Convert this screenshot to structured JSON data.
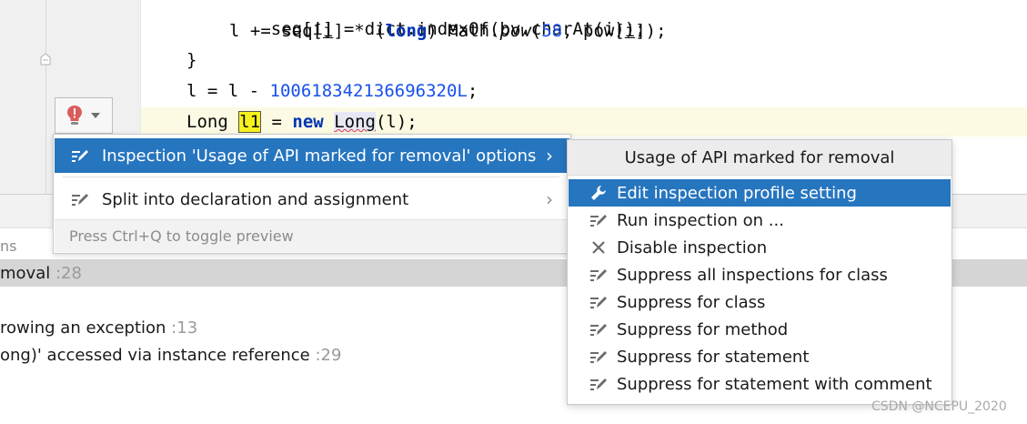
{
  "editor": {
    "code_lines": [
      {
        "a": "seq[i] = dict.indexOf(bv.charAt(i));"
      },
      {
        "a": "l += seq[",
        "b": "i",
        "c": "] * (",
        "kw": "long",
        "d": ") Math.",
        "it": "pow",
        "e": "(",
        "num": "58",
        "f": ", pow[",
        "g": "i",
        "h": "]);"
      },
      {
        "a": "}"
      },
      {
        "a": "l = l - ",
        "num": "100618342136696320L",
        "b": ";"
      },
      {
        "a": "Long ",
        "var": "l1",
        "b": " = ",
        "kw": "new",
        "c": " ",
        "dep": "Long",
        "d": "(l);"
      }
    ]
  },
  "intention_menu": {
    "items": [
      {
        "label": "Inspection 'Usage of API marked for removal' options",
        "icon": "pencil-icon",
        "arrow": "›"
      },
      {
        "label": "Split into declaration and assignment",
        "icon": "pencil-icon",
        "arrow": "›"
      }
    ],
    "footer": "Press Ctrl+Q to toggle preview"
  },
  "submenu": {
    "title": "Usage of API marked for removal",
    "items": [
      {
        "label": "Edit inspection profile setting",
        "icon": "wrench-icon"
      },
      {
        "label": "Run inspection on ...",
        "icon": "pencil-icon"
      },
      {
        "label": "Disable inspection",
        "icon": "close-icon"
      },
      {
        "label": "Suppress all inspections for class",
        "icon": "pencil-icon"
      },
      {
        "label": "Suppress for class",
        "icon": "pencil-icon"
      },
      {
        "label": "Suppress for method",
        "icon": "pencil-icon"
      },
      {
        "label": "Suppress for statement",
        "icon": "pencil-icon"
      },
      {
        "label": "Suppress for statement with comment",
        "icon": "pencil-icon"
      }
    ]
  },
  "problems": {
    "tab_fragment": "ns",
    "rows": [
      {
        "text": "moval",
        "count": ":28"
      },
      {
        "text": "rowing an exception",
        "count": ":13"
      },
      {
        "text": "ong)' accessed via instance reference",
        "count": ":29"
      }
    ]
  },
  "watermark": "CSDN @NCEPU_2020",
  "colors": {
    "selection": "#2675bf",
    "keyword": "#0033b3",
    "number": "#1750eb",
    "current_line": "#fcfae3"
  }
}
